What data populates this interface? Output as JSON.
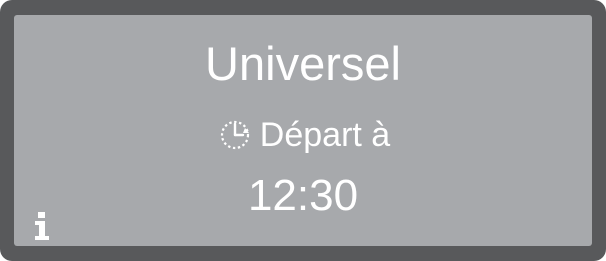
{
  "display": {
    "program_name": "Universel",
    "start_label": "Départ à",
    "start_time": "12:30",
    "start_icon": "clock-icon",
    "info_icon": "info-icon"
  },
  "colors": {
    "bezel": "#58595b",
    "screen": "#a7a9ac",
    "text": "#ffffff"
  }
}
